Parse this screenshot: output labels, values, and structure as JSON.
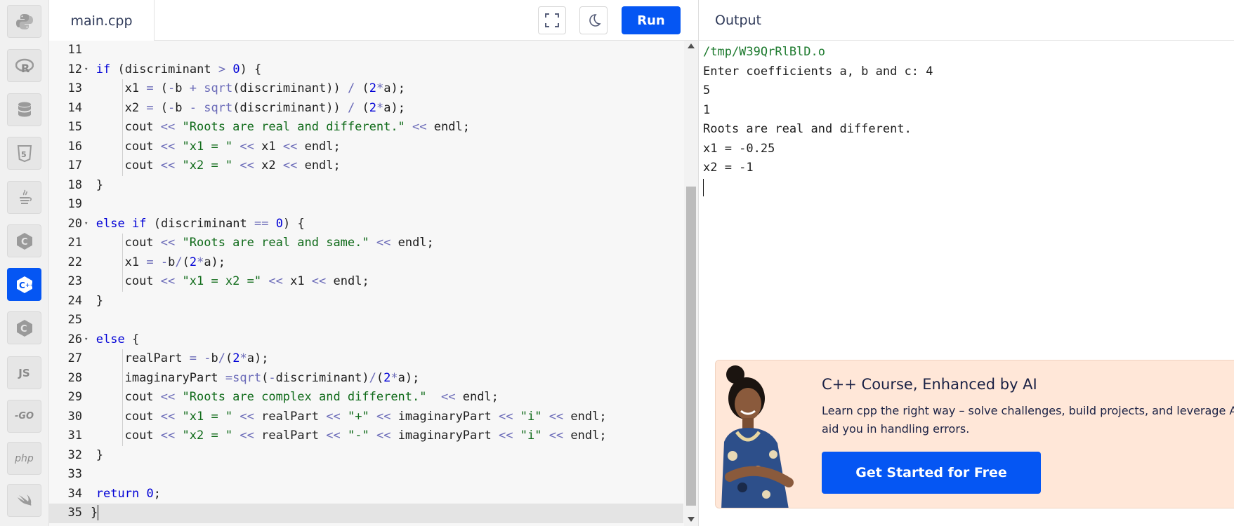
{
  "sidebar": {
    "items": [
      {
        "name": "python",
        "icon": "python-icon",
        "active": false
      },
      {
        "name": "r",
        "icon": "r-icon",
        "active": false
      },
      {
        "name": "sql",
        "icon": "database-icon",
        "active": false
      },
      {
        "name": "html",
        "icon": "html5-icon",
        "active": false
      },
      {
        "name": "java",
        "icon": "java-icon",
        "active": false
      },
      {
        "name": "c",
        "icon": "c-icon",
        "active": false
      },
      {
        "name": "cpp",
        "icon": "cpp-icon",
        "active": true
      },
      {
        "name": "csharp",
        "icon": "csharp-icon",
        "active": false
      },
      {
        "name": "js",
        "label": "JS",
        "icon": "js-icon",
        "active": false
      },
      {
        "name": "go",
        "label": "-GO",
        "icon": "go-icon",
        "active": false
      },
      {
        "name": "php",
        "label": "php",
        "icon": "php-icon",
        "active": false
      },
      {
        "name": "swift",
        "icon": "swift-icon",
        "active": false
      }
    ]
  },
  "editor": {
    "file_tab": "main.cpp",
    "run_label": "Run",
    "fullscreen_icon": "fullscreen-icon",
    "theme_icon": "moon-icon",
    "lines": [
      {
        "n": "11",
        "fold": false,
        "indent": 0,
        "html": ""
      },
      {
        "n": "12",
        "fold": true,
        "indent": 1,
        "html": "<span class=\"kw\">if</span> (discriminant <span class=\"op\">&gt;</span> <span class=\"num\">0</span>) {"
      },
      {
        "n": "13",
        "fold": false,
        "indent": 2,
        "html": "x1 <span class=\"op\">=</span> (<span class=\"op\">-</span>b <span class=\"op\">+</span> <span class=\"op\">sqrt</span>(discriminant)) <span class=\"op\">/</span> (<span class=\"num\">2</span><span class=\"op\">*</span>a);"
      },
      {
        "n": "14",
        "fold": false,
        "indent": 2,
        "html": "x2 <span class=\"op\">=</span> (<span class=\"op\">-</span>b <span class=\"op\">-</span> <span class=\"op\">sqrt</span>(discriminant)) <span class=\"op\">/</span> (<span class=\"num\">2</span><span class=\"op\">*</span>a);"
      },
      {
        "n": "15",
        "fold": false,
        "indent": 2,
        "html": "cout <span class=\"op\">&lt;&lt;</span> <span class=\"str\">\"Roots are real and different.\"</span> <span class=\"op\">&lt;&lt;</span> endl;"
      },
      {
        "n": "16",
        "fold": false,
        "indent": 2,
        "html": "cout <span class=\"op\">&lt;&lt;</span> <span class=\"str\">\"x1 = \"</span> <span class=\"op\">&lt;&lt;</span> x1 <span class=\"op\">&lt;&lt;</span> endl;"
      },
      {
        "n": "17",
        "fold": false,
        "indent": 2,
        "html": "cout <span class=\"op\">&lt;&lt;</span> <span class=\"str\">\"x2 = \"</span> <span class=\"op\">&lt;&lt;</span> x2 <span class=\"op\">&lt;&lt;</span> endl;"
      },
      {
        "n": "18",
        "fold": false,
        "indent": 1,
        "html": "}"
      },
      {
        "n": "19",
        "fold": false,
        "indent": 0,
        "html": ""
      },
      {
        "n": "20",
        "fold": true,
        "indent": 1,
        "html": "<span class=\"kw\">else</span> <span class=\"kw\">if</span> (discriminant <span class=\"op\">==</span> <span class=\"num\">0</span>) {"
      },
      {
        "n": "21",
        "fold": false,
        "indent": 2,
        "html": "cout <span class=\"op\">&lt;&lt;</span> <span class=\"str\">\"Roots are real and same.\"</span> <span class=\"op\">&lt;&lt;</span> endl;"
      },
      {
        "n": "22",
        "fold": false,
        "indent": 2,
        "html": "x1 <span class=\"op\">=</span> <span class=\"op\">-</span>b<span class=\"op\">/</span>(<span class=\"num\">2</span><span class=\"op\">*</span>a);"
      },
      {
        "n": "23",
        "fold": false,
        "indent": 2,
        "html": "cout <span class=\"op\">&lt;&lt;</span> <span class=\"str\">\"x1 = x2 =\"</span> <span class=\"op\">&lt;&lt;</span> x1 <span class=\"op\">&lt;&lt;</span> endl;"
      },
      {
        "n": "24",
        "fold": false,
        "indent": 1,
        "html": "}"
      },
      {
        "n": "25",
        "fold": false,
        "indent": 0,
        "html": ""
      },
      {
        "n": "26",
        "fold": true,
        "indent": 1,
        "html": "<span class=\"kw\">else</span> {"
      },
      {
        "n": "27",
        "fold": false,
        "indent": 2,
        "html": "realPart <span class=\"op\">=</span> <span class=\"op\">-</span>b<span class=\"op\">/</span>(<span class=\"num\">2</span><span class=\"op\">*</span>a);"
      },
      {
        "n": "28",
        "fold": false,
        "indent": 2,
        "html": "imaginaryPart <span class=\"op\">=</span><span class=\"op\">sqrt</span>(<span class=\"op\">-</span>discriminant)<span class=\"op\">/</span>(<span class=\"num\">2</span><span class=\"op\">*</span>a);"
      },
      {
        "n": "29",
        "fold": false,
        "indent": 2,
        "html": "cout <span class=\"op\">&lt;&lt;</span> <span class=\"str\">\"Roots are complex and different.\"</span>  <span class=\"op\">&lt;&lt;</span> endl;"
      },
      {
        "n": "30",
        "fold": false,
        "indent": 2,
        "html": "cout <span class=\"op\">&lt;&lt;</span> <span class=\"str\">\"x1 = \"</span> <span class=\"op\">&lt;&lt;</span> realPart <span class=\"op\">&lt;&lt;</span> <span class=\"str\">\"+\"</span> <span class=\"op\">&lt;&lt;</span> imaginaryPart <span class=\"op\">&lt;&lt;</span> <span class=\"str\">\"i\"</span> <span class=\"op\">&lt;&lt;</span> endl;"
      },
      {
        "n": "31",
        "fold": false,
        "indent": 2,
        "html": "cout <span class=\"op\">&lt;&lt;</span> <span class=\"str\">\"x2 = \"</span> <span class=\"op\">&lt;&lt;</span> realPart <span class=\"op\">&lt;&lt;</span> <span class=\"str\">\"-\"</span> <span class=\"op\">&lt;&lt;</span> imaginaryPart <span class=\"op\">&lt;&lt;</span> <span class=\"str\">\"i\"</span> <span class=\"op\">&lt;&lt;</span> endl;"
      },
      {
        "n": "32",
        "fold": false,
        "indent": 1,
        "html": "}"
      },
      {
        "n": "33",
        "fold": false,
        "indent": 0,
        "html": ""
      },
      {
        "n": "34",
        "fold": false,
        "indent": 1,
        "html": "<span class=\"kw\">return</span> <span class=\"num\">0</span>;"
      },
      {
        "n": "35",
        "fold": false,
        "indent": 0,
        "current": true,
        "html": "}<span class=\"cursor-bar\"></span>"
      }
    ]
  },
  "output": {
    "title": "Output",
    "lines": [
      "/tmp/W39QrRlBlD.o",
      "Enter coefficients a, b and c: 4",
      "5",
      "1",
      "Roots are real and different.",
      "x1 = -0.25",
      "x2 = -1"
    ]
  },
  "ad": {
    "title": "C++ Course, Enhanced by AI",
    "description": "Learn cpp the right way – solve challenges, build projects, and leverage AI to aid you in handling errors.",
    "cta": "Get Started for Free",
    "image_icon": "person-photo-icon"
  },
  "colors": {
    "accent": "#0556f3",
    "keyword": "#0000d6",
    "string": "#106b1a",
    "ad_bg": "#ffe7d8"
  }
}
